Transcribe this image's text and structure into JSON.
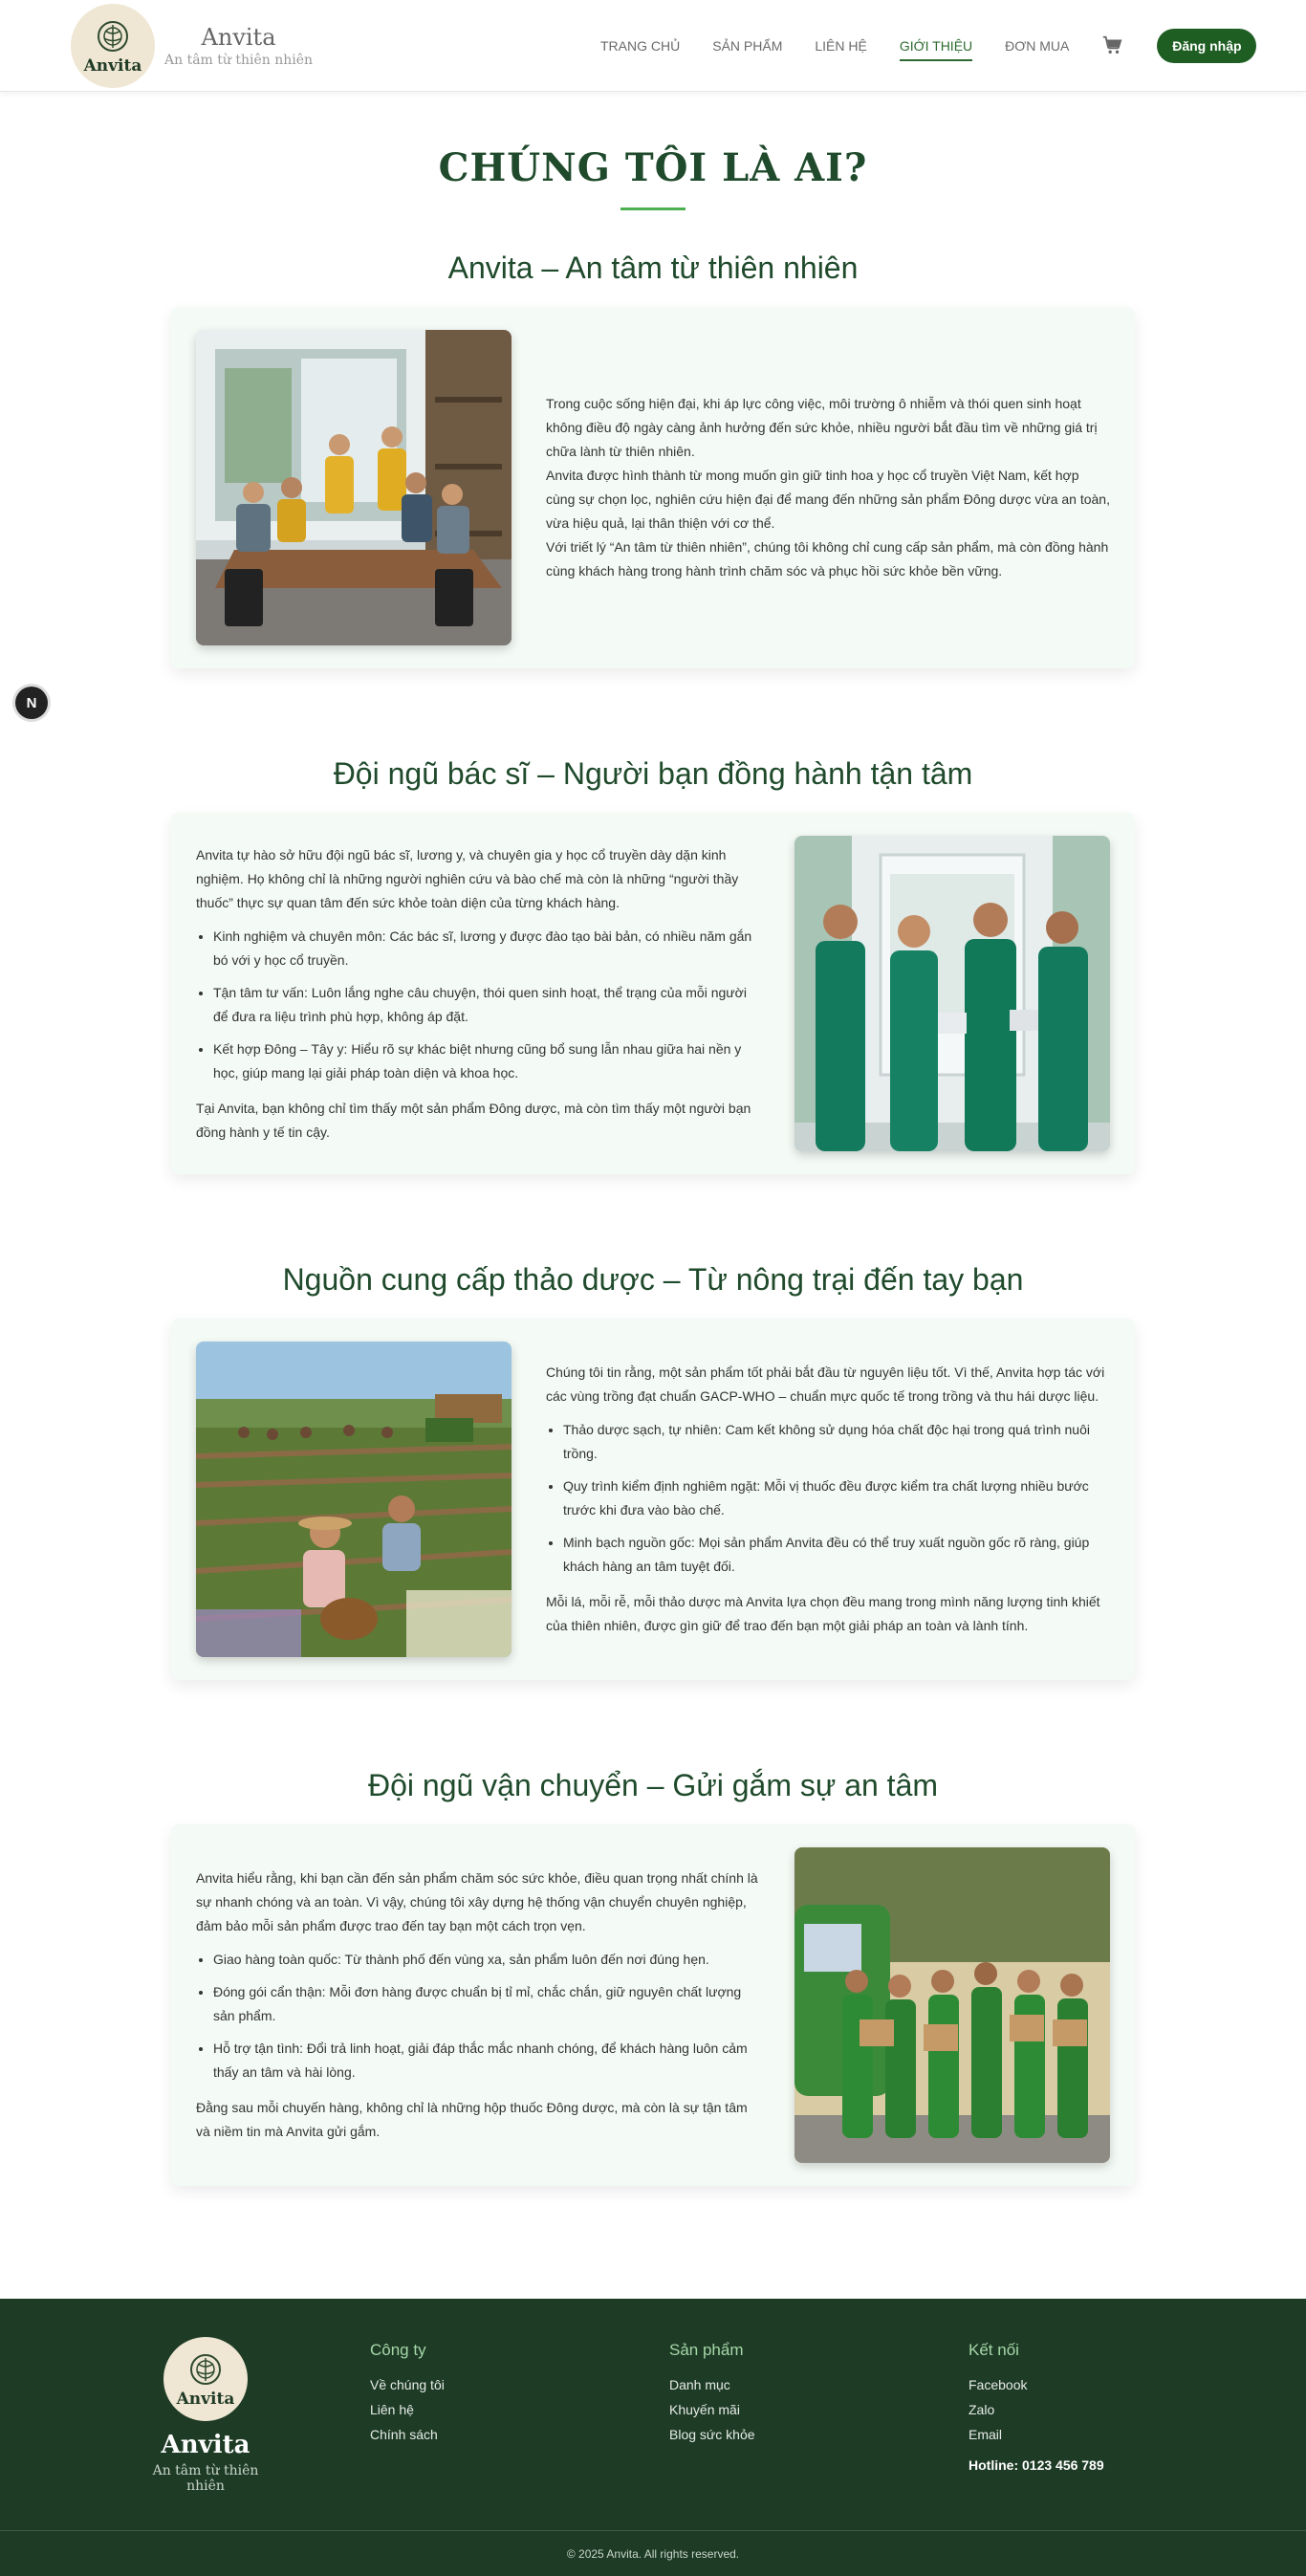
{
  "header": {
    "brand_name": "Anvita",
    "brand_tagline": "An tâm từ thiên nhiên",
    "logo_text": "Anvita",
    "nav": [
      {
        "label": "TRANG CHỦ"
      },
      {
        "label": "SẢN PHẨM"
      },
      {
        "label": "LIÊN HỆ"
      },
      {
        "label": "GIỚI THIỆU",
        "active": true
      },
      {
        "label": "ĐƠN MUA"
      }
    ],
    "cart_icon": "cart-icon",
    "login_label": "Đăng nhập"
  },
  "floating_badge": "N",
  "page_title": "CHÚNG TÔI LÀ AI?",
  "sections": {
    "intro": {
      "title": "Anvita – An tâm từ thiên nhiên",
      "image": "team-meeting-photo",
      "paragraphs": [
        "Trong cuộc sống hiện đại, khi áp lực công việc, môi trường ô nhiễm và thói quen sinh hoạt không điều độ ngày càng ảnh hưởng đến sức khỏe, nhiều người bắt đầu tìm về những giá trị chữa lành từ thiên nhiên.",
        "Anvita được hình thành từ mong muốn gìn giữ tinh hoa y học cổ truyền Việt Nam, kết hợp cùng sự chọn lọc, nghiên cứu hiện đại để mang đến những sản phẩm Đông dược vừa an toàn, vừa hiệu quả, lại thân thiện với cơ thể.",
        "Với triết lý “An tâm từ thiên nhiên”, chúng tôi không chỉ cung cấp sản phẩm, mà còn đồng hành cùng khách hàng trong hành trình chăm sóc và phục hồi sức khỏe bền vững."
      ]
    },
    "doctors": {
      "title": "Đội ngũ bác sĩ – Người bạn đồng hành tận tâm",
      "image": "doctors-team-photo",
      "intro": "Anvita tự hào sở hữu đội ngũ bác sĩ, lương y, và chuyên gia y học cổ truyền dày dặn kinh nghiệm. Họ không chỉ là những người nghiên cứu và bào chế mà còn là những “người thầy thuốc” thực sự quan tâm đến sức khỏe toàn diện của từng khách hàng.",
      "bullets": [
        "Kinh nghiệm và chuyên môn: Các bác sĩ, lương y được đào tạo bài bản, có nhiều năm gắn bó với y học cổ truyền.",
        "Tận tâm tư vấn: Luôn lắng nghe câu chuyện, thói quen sinh hoạt, thể trạng của mỗi người để đưa ra liệu trình phù hợp, không áp đặt.",
        "Kết hợp Đông – Tây y: Hiểu rõ sự khác biệt nhưng cũng bổ sung lẫn nhau giữa hai nền y học, giúp mang lại giải pháp toàn diện và khoa học."
      ],
      "outro": "Tại Anvita, bạn không chỉ tìm thấy một sản phẩm Đông dược, mà còn tìm thấy một người bạn đồng hành y tế tin cậy."
    },
    "herbs": {
      "title": "Nguồn cung cấp thảo dược – Từ nông trại đến tay bạn",
      "image": "herb-farm-photo",
      "intro": "Chúng tôi tin rằng, một sản phẩm tốt phải bắt đầu từ nguyên liệu tốt. Vì thế, Anvita hợp tác với các vùng trồng đạt chuẩn GACP-WHO – chuẩn mực quốc tế trong trồng và thu hái dược liệu.",
      "bullets": [
        "Thảo dược sạch, tự nhiên: Cam kết không sử dụng hóa chất độc hại trong quá trình nuôi trồng.",
        "Quy trình kiểm định nghiêm ngặt: Mỗi vị thuốc đều được kiểm tra chất lượng nhiều bước trước khi đưa vào bào chế.",
        "Minh bạch nguồn gốc: Mọi sản phẩm Anvita đều có thể truy xuất nguồn gốc rõ ràng, giúp khách hàng an tâm tuyệt đối."
      ],
      "outro": "Mỗi lá, mỗi rễ, mỗi thảo dược mà Anvita lựa chọn đều mang trong mình năng lượng tinh khiết của thiên nhiên, được gìn giữ để trao đến bạn một giải pháp an toàn và lành tính."
    },
    "delivery": {
      "title": "Đội ngũ vận chuyển – Gửi gắm sự an tâm",
      "image": "delivery-team-photo",
      "intro": "Anvita hiểu rằng, khi bạn cần đến sản phẩm chăm sóc sức khỏe, điều quan trọng nhất chính là sự nhanh chóng và an toàn. Vì vậy, chúng tôi xây dựng hệ thống vận chuyển chuyên nghiệp, đảm bảo mỗi sản phẩm được trao đến tay bạn một cách trọn vẹn.",
      "bullets": [
        "Giao hàng toàn quốc: Từ thành phố đến vùng xa, sản phẩm luôn đến nơi đúng hẹn.",
        "Đóng gói cẩn thận: Mỗi đơn hàng được chuẩn bị tỉ mỉ, chắc chắn, giữ nguyên chất lượng sản phẩm.",
        "Hỗ trợ tận tình: Đổi trả linh hoạt, giải đáp thắc mắc nhanh chóng, để khách hàng luôn cảm thấy an tâm và hài lòng."
      ],
      "outro": "Đằng sau mỗi chuyến hàng, không chỉ là những hộp thuốc Đông dược, mà còn là sự tận tâm và niềm tin mà Anvita gửi gắm."
    }
  },
  "footer": {
    "logo_text": "Anvita",
    "brand_name": "Anvita",
    "brand_tagline": "An tâm từ thiên nhiên",
    "company": {
      "title": "Công ty",
      "links": [
        "Về chúng tôi",
        "Liên hệ",
        "Chính sách"
      ]
    },
    "products": {
      "title": "Sản phẩm",
      "links": [
        "Danh mục",
        "Khuyến mãi",
        "Blog sức khỏe"
      ]
    },
    "connect": {
      "title": "Kết nối",
      "links": [
        "Facebook",
        "Zalo",
        "Email"
      ]
    },
    "hotline": "Hotline: 0123 456 789",
    "copyright": "© 2025 Anvita. All rights reserved."
  },
  "colors": {
    "primary": "#1e5e22",
    "footer_bg": "#1e3b26",
    "card_bg": "#f4faf5",
    "accent": "#4caf50"
  }
}
